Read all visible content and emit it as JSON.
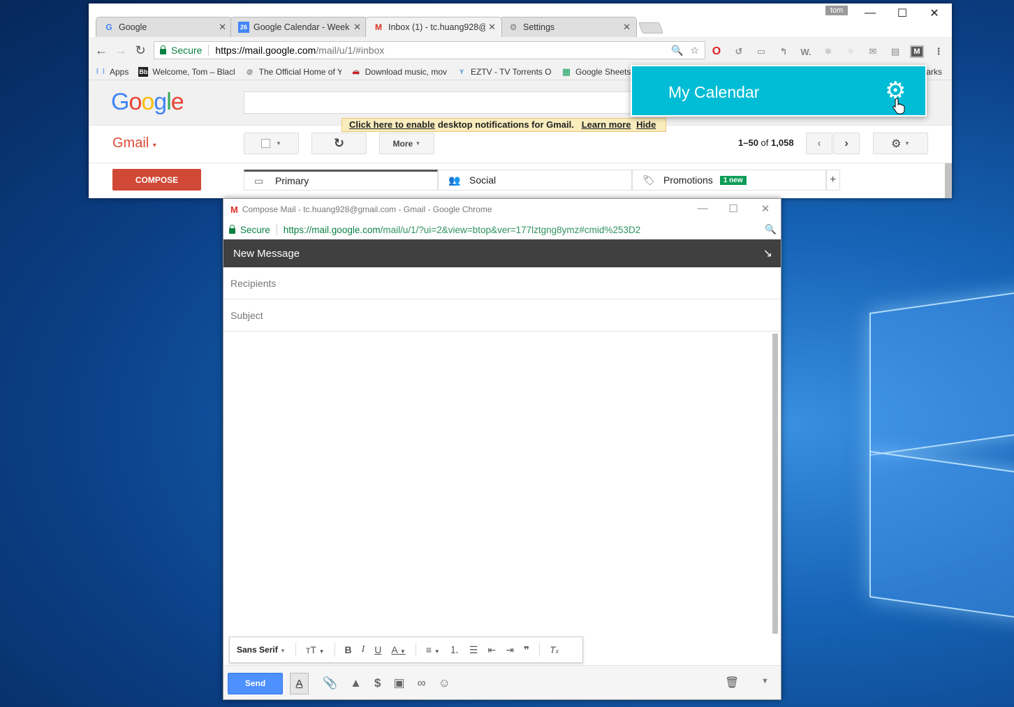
{
  "browser": {
    "user": "tom",
    "tabs": [
      {
        "title": "Google",
        "icon": "G"
      },
      {
        "title": "Google Calendar - Week",
        "icon": "26"
      },
      {
        "title": "Inbox (1) - tc.huang928@",
        "icon": "M"
      },
      {
        "title": "Settings",
        "icon": "⚙"
      }
    ],
    "secure_label": "Secure",
    "url_host": "https://mail.google.com",
    "url_path": "/mail/u/1/#inbox",
    "bookmarks": [
      {
        "label": "Apps",
        "icon": "⋮⋮"
      },
      {
        "label": "Welcome, Tom – Blacl",
        "icon": "Bb"
      },
      {
        "label": "The Official Home of Y",
        "icon": "@"
      },
      {
        "label": "Download music, mov",
        "icon": "🚗"
      },
      {
        "label": "EZTV - TV Torrents Or",
        "icon": "Y"
      },
      {
        "label": "Google Sheets",
        "icon": "▦"
      }
    ],
    "bookmarks_tail": "arks"
  },
  "gmail": {
    "logo": "Google",
    "label": "Gmail",
    "notification": {
      "link": "Click here to enable",
      "text": "desktop notifications for Gmail.",
      "learn_more": "Learn more",
      "hide": "Hide"
    },
    "more_label": "More",
    "pager": {
      "range": "1–50",
      "of": "of",
      "total": "1,058"
    },
    "compose_label": "COMPOSE",
    "tabs": [
      {
        "label": "Primary"
      },
      {
        "label": "Social"
      },
      {
        "label": "Promotions",
        "badge": "1 new"
      }
    ]
  },
  "popup": {
    "title": "My Calendar"
  },
  "compose_window": {
    "window_title": "Compose Mail - tc.huang928@gmail.com - Gmail - Google Chrome",
    "secure_label": "Secure",
    "url_host": "https://mail.google.com",
    "url_path": "/mail/u/1/?ui=2&view=btop&ver=177lztgng8ymz#cmid%253D2",
    "header": "New Message",
    "recipients_placeholder": "Recipients",
    "subject_placeholder": "Subject",
    "font_name": "Sans Serif",
    "send_label": "Send"
  }
}
